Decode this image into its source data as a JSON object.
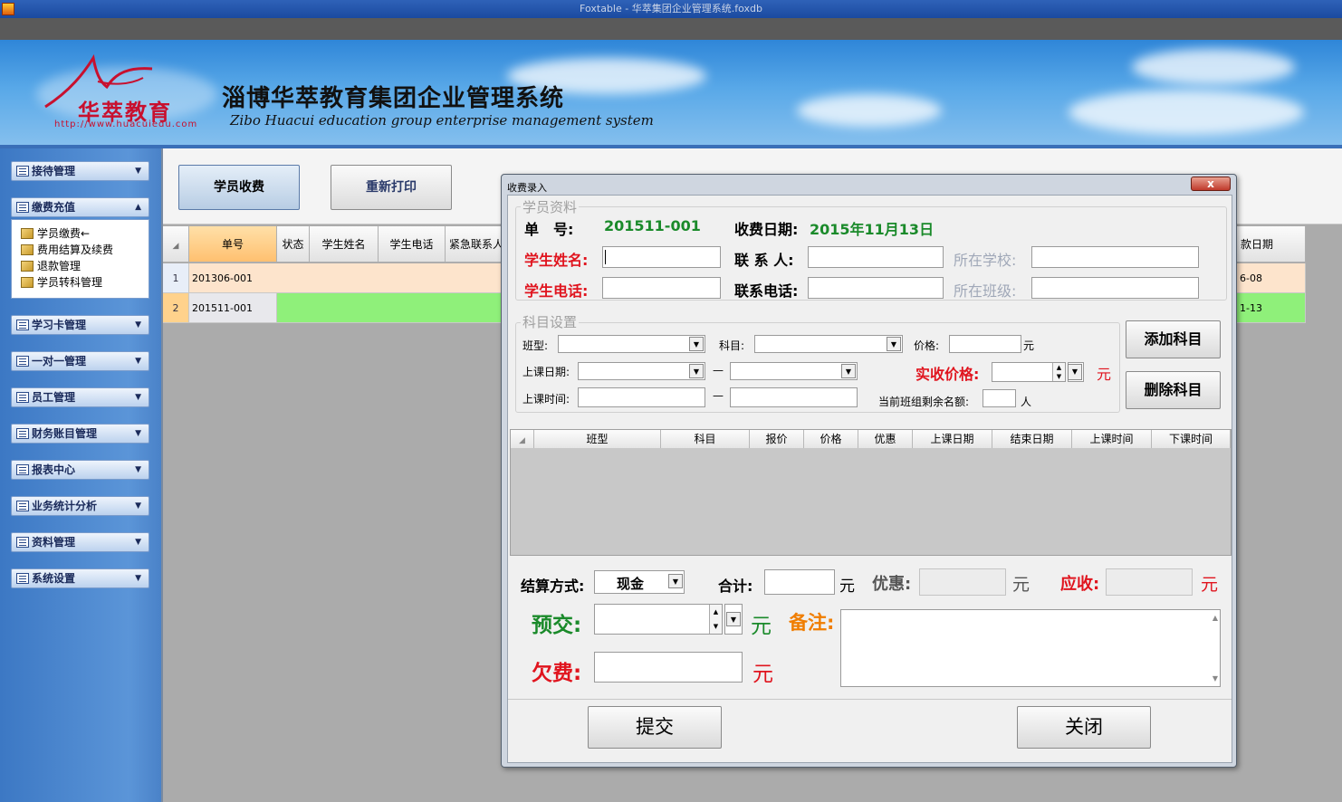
{
  "window": {
    "title": "Foxtable - 华萃集团企业管理系统.foxdb"
  },
  "banner": {
    "logo_text": "华萃教育",
    "logo_url": "http://www.huacuiedu.com",
    "system_title": "淄博华萃教育集团企业管理系统",
    "system_subtitle": "Zibo Huacui education group enterprise management system"
  },
  "sidebar": {
    "groups": [
      {
        "label": "接待管理",
        "expanded": false
      },
      {
        "label": "缴费充值",
        "expanded": true
      },
      {
        "label": "学习卡管理",
        "expanded": false
      },
      {
        "label": "一对一管理",
        "expanded": false
      },
      {
        "label": "员工管理",
        "expanded": false
      },
      {
        "label": "财务账目管理",
        "expanded": false
      },
      {
        "label": "报表中心",
        "expanded": false
      },
      {
        "label": "业务统计分析",
        "expanded": false
      },
      {
        "label": "资料管理",
        "expanded": false
      },
      {
        "label": "系统设置",
        "expanded": false
      }
    ],
    "sub_items": [
      "学员缴费←",
      "费用结算及续费",
      "退款管理",
      "学员转科管理"
    ]
  },
  "toolbar": {
    "pay_label": "学员收费",
    "reprint_label": "重新打印"
  },
  "main_grid": {
    "columns": [
      "单号",
      "状态",
      "学生姓名",
      "学生电话",
      "紧急联系人",
      "款日期"
    ],
    "rows": [
      {
        "num": "1",
        "order": "201306-001",
        "date_tail": "6-08"
      },
      {
        "num": "2",
        "order": "201511-001",
        "date_tail": "1-13"
      }
    ]
  },
  "dialog": {
    "title": "收费录入",
    "close_label": "x",
    "student_section": {
      "legend": "学员资料",
      "order_label": "单　号:",
      "order_value": "201511-001",
      "date_label": "收费日期:",
      "date_value": "2015年11月13日",
      "name_label": "学生姓名:",
      "contact_label": "联 系 人:",
      "school_label": "所在学校:",
      "phone_label": "学生电话:",
      "contact_phone_label": "联系电话:",
      "class_label": "所在班级:"
    },
    "subject_section": {
      "legend": "科目设置",
      "class_type_label": "班型:",
      "subject_label": "科目:",
      "price_label": "价格:",
      "yuan": "元",
      "start_date_label": "上课日期:",
      "dash": "—",
      "actual_price_label": "实收价格:",
      "time_label": "上课时间:",
      "remaining_label": "当前班组剩余名额:",
      "person_unit": "人",
      "add_button": "添加科目",
      "delete_button": "删除科目"
    },
    "subject_grid": {
      "columns": [
        "班型",
        "科目",
        "报价",
        "价格",
        "优惠",
        "上课日期",
        "结束日期",
        "上课时间",
        "下课时间"
      ]
    },
    "settlement": {
      "method_label": "结算方式:",
      "method_value": "现金",
      "total_label": "合计:",
      "discount_label": "优惠:",
      "receivable_label": "应收:",
      "prepay_label": "预交:",
      "note_label": "备注:",
      "arrears_label": "欠费:",
      "yuan": "元"
    },
    "submit_button": "提交",
    "close_button": "关闭"
  },
  "colors": {
    "red_label": "#e0141e",
    "green_value": "#1a8a2a",
    "row1_bg": "#fde4cc",
    "row2_bg": "#8ff07a",
    "header_highlight": "#ffd28c"
  }
}
